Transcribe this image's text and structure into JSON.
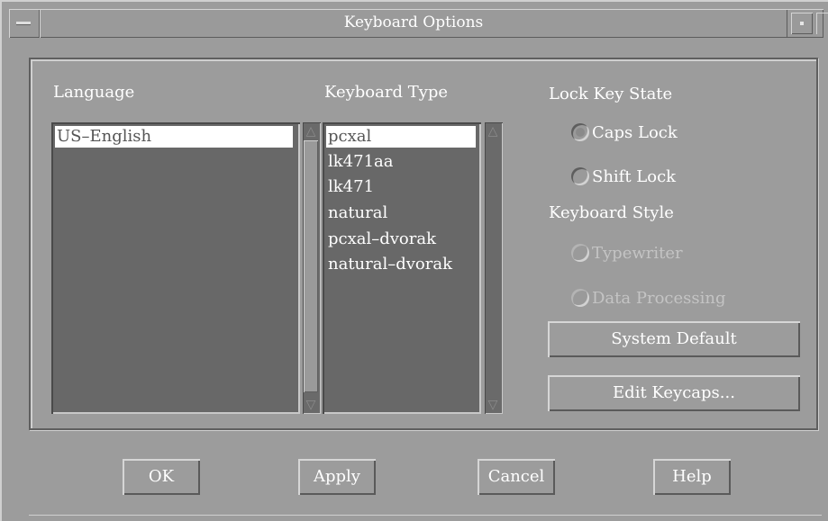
{
  "window": {
    "title": "Keyboard Options"
  },
  "language": {
    "label": "Language",
    "items": [
      "US–English"
    ],
    "selected_index": 0
  },
  "keyboard_type": {
    "label": "Keyboard Type",
    "items": [
      "pcxal",
      "lk471aa",
      "lk471",
      "natural",
      "pcxal–dvorak",
      "natural–dvorak"
    ],
    "selected_index": 0
  },
  "lock_key_state": {
    "label": "Lock Key State",
    "options": [
      {
        "label": "Caps Lock",
        "checked": true,
        "enabled": true
      },
      {
        "label": "Shift Lock",
        "checked": false,
        "enabled": true
      }
    ]
  },
  "keyboard_style": {
    "label": "Keyboard Style",
    "options": [
      {
        "label": "Typewriter",
        "checked": false,
        "enabled": false
      },
      {
        "label": "Data Processing",
        "checked": false,
        "enabled": false
      }
    ]
  },
  "buttons": {
    "system_default": "System Default",
    "edit_keycaps": "Edit Keycaps...",
    "ok": "OK",
    "apply": "Apply",
    "cancel": "Cancel",
    "help": "Help"
  },
  "icons": {
    "window_menu": "window-menu-icon",
    "minimize": "minimize-icon",
    "scroll_up": "scroll-up-arrow-icon",
    "scroll_down": "scroll-down-arrow-icon"
  },
  "colors": {
    "background": "#9a9a9a",
    "list_background": "#686868",
    "selection": "#ffffff",
    "text": "#ffffff",
    "disabled_text": "#c4c4c4"
  }
}
